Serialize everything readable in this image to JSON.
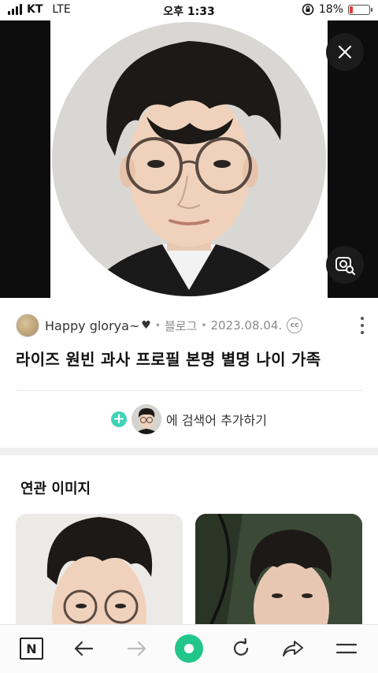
{
  "status_bar": {
    "carrier": "KT",
    "network": "LTE",
    "time": "오후 1:33",
    "battery_percent": "18%",
    "battery_level": 0.18
  },
  "viewer": {
    "close_icon": "close-icon",
    "lens_icon": "image-search-lens-icon"
  },
  "source": {
    "name": "Happy glorya~",
    "type": "블로그",
    "date": "2023.08.04.",
    "cc": "cc"
  },
  "title": "라이즈 원빈 과사 프로필 본명 별명 나이 가족",
  "add_search": {
    "label": "에 검색어 추가하기",
    "plus": "+"
  },
  "related": {
    "title": "연관 이미지"
  },
  "bottom_nav": {
    "n_label": "N",
    "icons": [
      "naver-home-icon",
      "back-arrow-icon",
      "forward-arrow-icon",
      "green-dot-icon",
      "refresh-icon",
      "share-icon",
      "menu-icon"
    ]
  },
  "colors": {
    "accent_green": "#22c68a",
    "plus_teal": "#41d3b7",
    "battery_low": "#e53935"
  }
}
